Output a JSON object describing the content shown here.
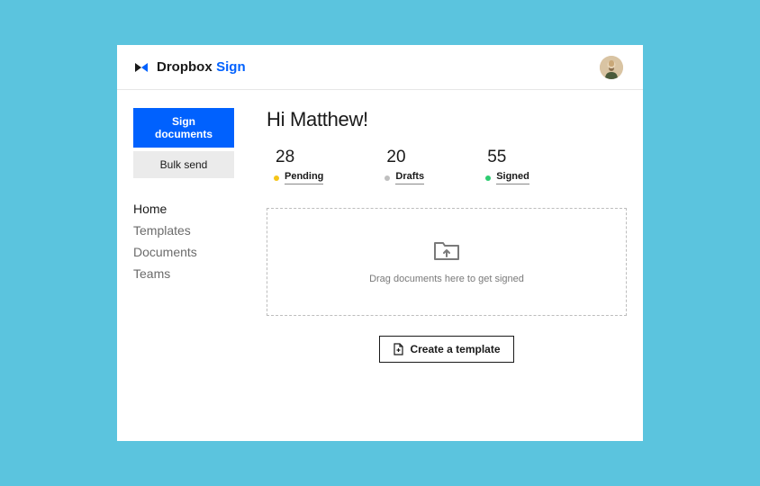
{
  "brand": {
    "name": "Dropbox",
    "accent": "Sign"
  },
  "sidebar": {
    "primary_button": "Sign documents",
    "secondary_button": "Bulk send",
    "nav": [
      {
        "label": "Home",
        "active": true
      },
      {
        "label": "Templates",
        "active": false
      },
      {
        "label": "Documents",
        "active": false
      },
      {
        "label": "Teams",
        "active": false
      }
    ]
  },
  "main": {
    "greeting": "Hi Matthew!",
    "stats": [
      {
        "value": "28",
        "label": "Pending",
        "status": "pending"
      },
      {
        "value": "20",
        "label": "Drafts",
        "status": "drafts"
      },
      {
        "value": "55",
        "label": "Signed",
        "status": "signed"
      }
    ],
    "dropzone_text": "Drag documents here to get signed",
    "create_template_label": "Create a template"
  },
  "colors": {
    "accent": "#0061fe",
    "bg": "#5bc4de",
    "pending": "#f5c518",
    "drafts": "#bfbfbf",
    "signed": "#2ecc71"
  }
}
